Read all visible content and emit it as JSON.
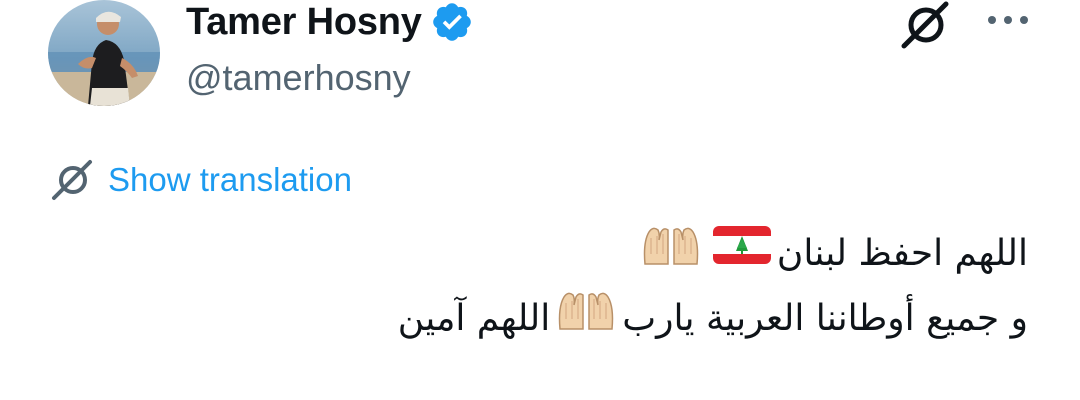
{
  "tweet": {
    "author": {
      "display_name": "Tamer Hosny",
      "handle": "@tamerhosny",
      "verified": true,
      "verified_badge_color": "#1d9bf0",
      "avatar_icon": "profile-photo"
    },
    "actions": {
      "grok_icon": "grok-icon",
      "more_icon": "more-options-icon"
    },
    "translation": {
      "label": "Show translation",
      "icon": "grok-translate-icon",
      "color": "#1d9bf0"
    },
    "text": {
      "line1_text": "اللهم احفظ لبنان",
      "line1_emojis": [
        "lebanon-flag",
        "praying-hands"
      ],
      "line2_part1": "و جميع أوطاننا العربية يارب",
      "line2_emoji": "praying-hands",
      "line2_part2": "اللهم آمين"
    }
  }
}
